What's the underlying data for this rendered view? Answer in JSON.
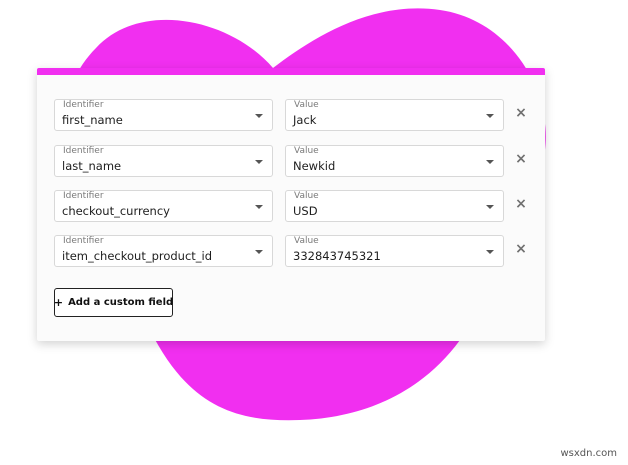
{
  "colors": {
    "brand_magenta": "#f12ff0",
    "card_background": "#fbfbfb",
    "field_border": "#d8d8d8"
  },
  "custom_fields": [
    {
      "identifier_label": "Identifier",
      "identifier": "first_name",
      "value_label": "Value",
      "value": "Jack"
    },
    {
      "identifier_label": "Identifier",
      "identifier": "last_name",
      "value_label": "Value",
      "value": "Newkid"
    },
    {
      "identifier_label": "Identifier",
      "identifier": "checkout_currency",
      "value_label": "Value",
      "value": "USD"
    },
    {
      "identifier_label": "Identifier",
      "identifier": "item_checkout_product_id",
      "value_label": "Value",
      "value": "332843745321"
    }
  ],
  "remove_icon": "×",
  "add_button": {
    "icon": "+",
    "label": "Add a custom field"
  },
  "watermark": "wsxdn.com"
}
